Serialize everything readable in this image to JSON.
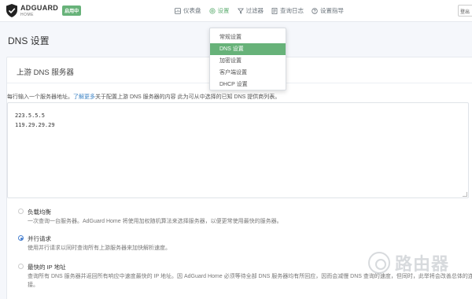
{
  "header": {
    "logo_name": "ADGUARD",
    "logo_sub": "HOME",
    "status_badge": "启用中",
    "nav": [
      {
        "label": "仪表盘",
        "icon": "dashboard-icon",
        "active": false
      },
      {
        "label": "设置",
        "icon": "gear-icon",
        "active": true
      },
      {
        "label": "过滤器",
        "icon": "filter-icon",
        "active": false
      },
      {
        "label": "查询日志",
        "icon": "log-icon",
        "active": false
      },
      {
        "label": "设置指导",
        "icon": "help-icon",
        "active": false
      }
    ],
    "logout_label": "登出"
  },
  "settings_menu": {
    "items": [
      {
        "label": "常规设置",
        "active": false
      },
      {
        "label": "DNS 设置",
        "active": true
      },
      {
        "label": "加密设置",
        "active": false
      },
      {
        "label": "客户端设置",
        "active": false
      },
      {
        "label": "DHCP 设置",
        "active": false
      }
    ]
  },
  "page": {
    "title": "DNS 设置"
  },
  "upstream": {
    "card_title": "上游 DNS 服务器",
    "desc_prefix": "每行输入一个服务器地址。",
    "desc_link": "了解更多",
    "desc_rest": "关于配置上游 DNS 服务器的内容 此为可从中选择的已知 DNS 提供商列表。",
    "servers": "223.5.5.5\n119.29.29.29",
    "options": [
      {
        "title": "负载均衡",
        "desc": "一次查询一台服务器。AdGuard Home 将使用加权随机算法来选择服务器，以便更常使用最快的服务器。",
        "checked": false
      },
      {
        "title": "并行请求",
        "desc": "使用并行请求以同时查询所有上游服务器来加快解析速度。",
        "checked": true
      },
      {
        "title": "最快的 IP 地址",
        "desc": "查询所有 DNS 服务器并返回所有响应中速度最快的 IP 地址。因 AdGuard Home 必须等待全部 DNS 服务器均有所回应，因而会减慢 DNS 查询的速度，但同时，此举将会改善总体的连接。",
        "checked": false
      }
    ]
  },
  "watermark": {
    "text": "路由器"
  }
}
